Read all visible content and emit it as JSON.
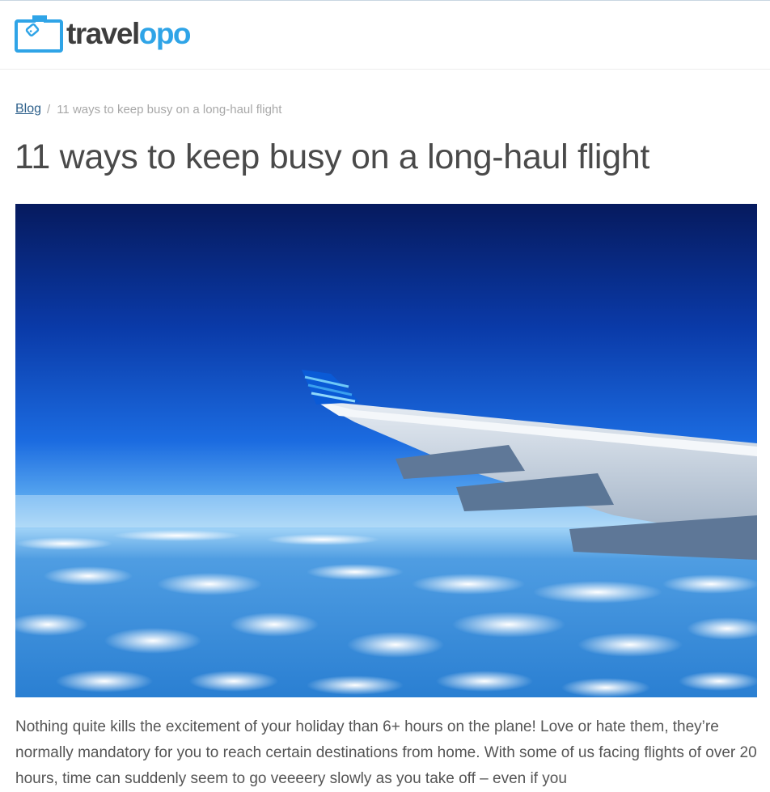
{
  "brand": {
    "name_part1": "travel",
    "name_part2": "opo",
    "accent_color": "#2fa4e7",
    "dark_color": "#3d3d3d",
    "icon": "suitcase-icon"
  },
  "breadcrumb": {
    "link_label": "Blog",
    "separator": "/",
    "current": "11 ways to keep busy on a long-haul flight"
  },
  "article": {
    "title": "11 ways to keep busy on a long-haul flight",
    "hero_image": "airplane-wing-above-clouds",
    "intro": "Nothing quite kills the excitement of your holiday than 6+ hours on the plane! Love or hate them, they’re normally mandatory for you to reach certain destinations from home. With some of us facing flights of over 20 hours, time can suddenly seem to go veeeery slowly as you take off – even if you"
  }
}
